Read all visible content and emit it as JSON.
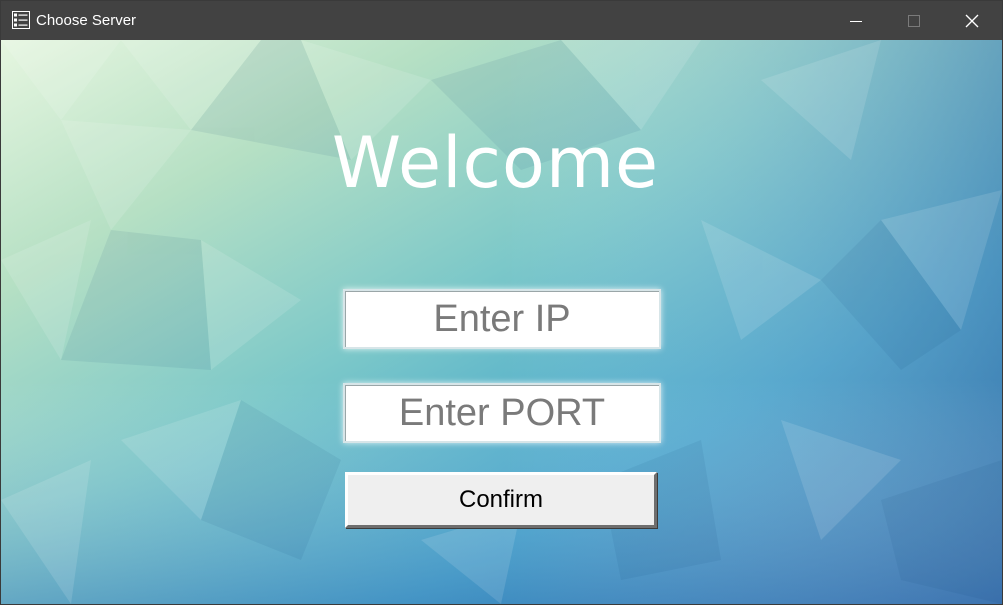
{
  "window": {
    "title": "Choose Server",
    "app_icon": "list-window-icon",
    "controls": {
      "minimize_icon": "minimize-icon",
      "maximize_icon": "maximize-icon",
      "close_icon": "close-icon"
    }
  },
  "main": {
    "heading": "Welcome",
    "ip_field": {
      "value": "",
      "placeholder": "Enter IP"
    },
    "port_field": {
      "value": "",
      "placeholder": "Enter PORT"
    },
    "confirm_label": "Confirm"
  },
  "colors": {
    "titlebar": "#424242",
    "background_top_left": "#e3f3df",
    "background_bottom_right": "#1d6fb0",
    "heading": "#ffffff",
    "placeholder": "#7a7a7a",
    "button_face": "#efefef"
  }
}
